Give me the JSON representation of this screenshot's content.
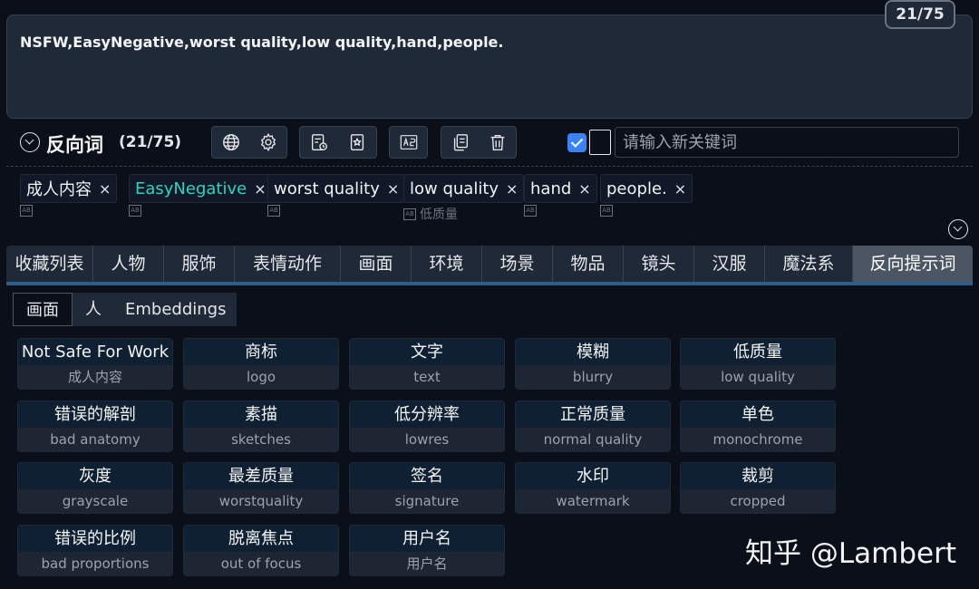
{
  "prompt": {
    "text": "NSFW,EasyNegative,worst quality,low quality,hand,people.",
    "counter": "21/75"
  },
  "toolbar": {
    "title": "反向词",
    "count": "(21/75)",
    "keyword_placeholder": "请输入新关键词"
  },
  "tags": [
    {
      "label": "成人内容",
      "sub": ""
    },
    {
      "label": "EasyNegative",
      "sub": ""
    },
    {
      "label": "worst quality",
      "sub": ""
    },
    {
      "label": "low quality",
      "sub": "低质量"
    },
    {
      "label": "hand",
      "sub": ""
    },
    {
      "label": "people.",
      "sub": ""
    }
  ],
  "tag_close": "×",
  "tag_translate_icon": "AB",
  "category_tabs": [
    "收藏列表",
    "人物",
    "服饰",
    "表情动作",
    "画面",
    "环境",
    "场景",
    "物品",
    "镜头",
    "汉服",
    "魔法系",
    "反向提示词"
  ],
  "sub_tabs": [
    "画面",
    "人",
    "Embeddings"
  ],
  "keywords": [
    {
      "top": "Not Safe For Work",
      "bottom": "成人内容"
    },
    {
      "top": "商标",
      "bottom": "logo"
    },
    {
      "top": "文字",
      "bottom": "text"
    },
    {
      "top": "模糊",
      "bottom": "blurry"
    },
    {
      "top": "低质量",
      "bottom": "low quality"
    },
    {
      "top": "错误的解剖",
      "bottom": "bad anatomy"
    },
    {
      "top": "素描",
      "bottom": "sketches"
    },
    {
      "top": "低分辨率",
      "bottom": "lowres"
    },
    {
      "top": "正常质量",
      "bottom": "normal quality"
    },
    {
      "top": "单色",
      "bottom": "monochrome"
    },
    {
      "top": "灰度",
      "bottom": "grayscale"
    },
    {
      "top": "最差质量",
      "bottom": "worstquality"
    },
    {
      "top": "签名",
      "bottom": "signature"
    },
    {
      "top": "水印",
      "bottom": "watermark"
    },
    {
      "top": "裁剪",
      "bottom": "cropped"
    },
    {
      "top": "错误的比例",
      "bottom": "bad proportions"
    },
    {
      "top": "脱离焦点",
      "bottom": "out of focus"
    },
    {
      "top": "用户名",
      "bottom": "用户名"
    }
  ],
  "watermark": "知乎 @Lambert",
  "colors": {
    "accent": "#3b82f6",
    "teal_tag": "#2dd4bf",
    "active_tab_bar": "#2f5d8a"
  }
}
